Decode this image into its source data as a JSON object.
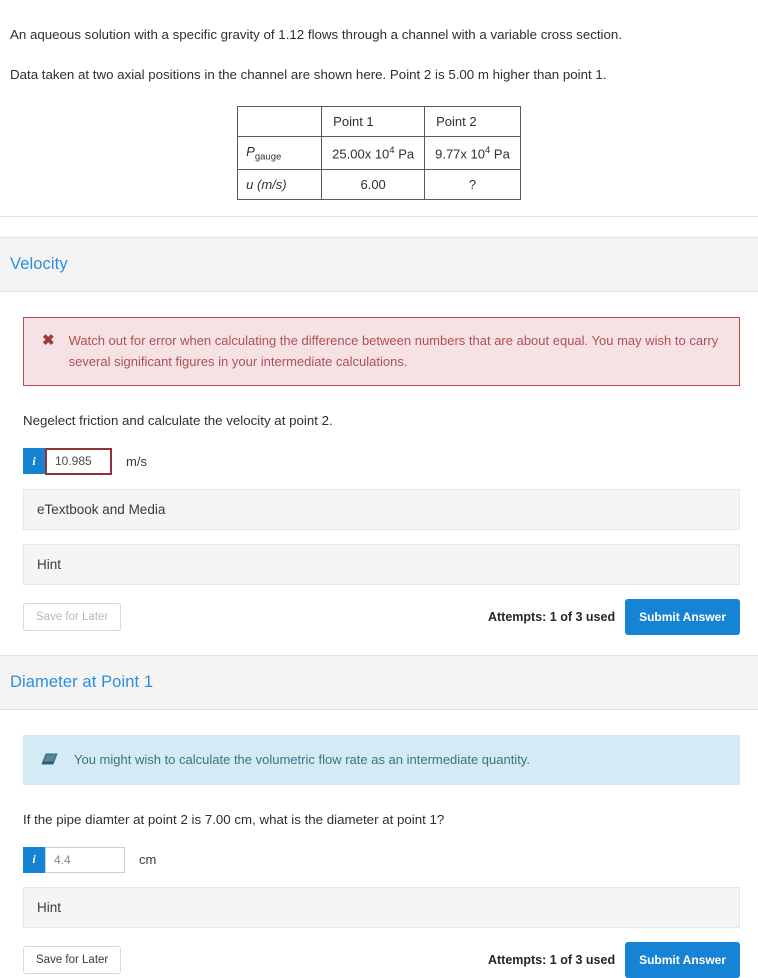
{
  "statement": {
    "line1": "An aqueous solution with a specific gravity of 1.12 flows through a channel with a variable cross section.",
    "line2": "Data taken at two axial positions in the channel are shown here. Point 2 is 5.00 m higher than point 1."
  },
  "data_table": {
    "corner": "",
    "columns": [
      "Point 1",
      "Point 2"
    ],
    "rows": [
      {
        "label_main": "P",
        "label_sub": "gauge",
        "cells": [
          {
            "mantissa": "25.00x 10",
            "exponent": "4",
            "unit": "Pa"
          },
          {
            "mantissa": "9.77x 10",
            "exponent": "4",
            "unit": "Pa"
          }
        ]
      },
      {
        "label_main": "u (m/s)",
        "label_sub": "",
        "cells": [
          {
            "mantissa": "6.00",
            "exponent": "",
            "unit": ""
          },
          {
            "mantissa": "?",
            "exponent": "",
            "unit": ""
          }
        ]
      }
    ]
  },
  "sections": [
    {
      "title": "Velocity",
      "alert": {
        "kind": "error",
        "icon": "error-x-icon",
        "text": "Watch out for error when calculating the difference between numbers that are about equal. You may wish to carry several significant figures in your intermediate calculations."
      },
      "prompt": "Negelect friction and calculate the velocity at point 2.",
      "answer": {
        "badge": "i",
        "value": "10.985",
        "placeholder": "",
        "unit": "m/s",
        "state": "error"
      },
      "accordions": [
        "eTextbook and Media",
        "Hint"
      ],
      "save_label": "Save for Later",
      "save_state": "disabled",
      "attempts": "Attempts: 1 of 3 used",
      "submit_label": "Submit Answer"
    },
    {
      "title": "Diameter at Point 1",
      "alert": {
        "kind": "info",
        "icon": "tip-eraser-icon",
        "text": "You might wish to calculate the volumetric flow rate as an intermediate quantity."
      },
      "prompt": "If the pipe diamter at point 2 is 7.00 cm, what is the diameter at point 1?",
      "answer": {
        "badge": "i",
        "value": "4.4",
        "placeholder": "",
        "unit": "cm",
        "state": "normal"
      },
      "accordions": [
        "Hint"
      ],
      "save_label": "Save for Later",
      "save_state": "enabled",
      "attempts": "Attempts: 1 of 3 used",
      "submit_label": "Submit Answer"
    }
  ],
  "colors": {
    "section_title": "#2b8fe0",
    "submit_button": "#1783d4",
    "info_badge": "#1683d2",
    "error_border": "#b34f54",
    "error_bg": "#f6e2e4",
    "error_text": "#b05055",
    "info_bg": "#d4ebf5",
    "info_text": "#3c7288"
  }
}
